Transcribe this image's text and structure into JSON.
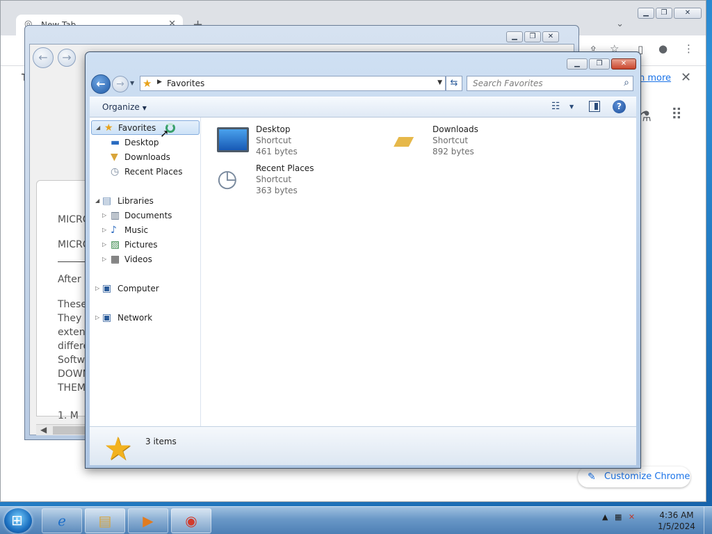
{
  "chrome": {
    "tab_title": "New Tab",
    "notice_prefix": "T",
    "learn_more": "n more",
    "customize_label": "Customize Chrome"
  },
  "document_window": {
    "lines": [
      "MICRO",
      "MICRO",
      "After i",
      "These",
      "They a",
      "extent",
      "differe",
      "Softwa",
      "DOWN",
      "THEM",
      "1.    M"
    ]
  },
  "explorer": {
    "address_crumb": "Favorites",
    "search_placeholder": "Search Favorites",
    "organize_label": "Organize",
    "help_label": "?",
    "nav_tree": {
      "favorites": "Favorites",
      "favorites_children": [
        "Desktop",
        "Downloads",
        "Recent Places"
      ],
      "libraries": "Libraries",
      "libraries_children": [
        "Documents",
        "Music",
        "Pictures",
        "Videos"
      ],
      "computer": "Computer",
      "network": "Network"
    },
    "items": [
      {
        "name": "Desktop",
        "type": "Shortcut",
        "size": "461 bytes",
        "icon": "desktop-icon"
      },
      {
        "name": "Downloads",
        "type": "Shortcut",
        "size": "892 bytes",
        "icon": "downloads-folder-icon"
      },
      {
        "name": "Recent Places",
        "type": "Shortcut",
        "size": "363 bytes",
        "icon": "recent-places-icon"
      }
    ],
    "status_text": "3 items"
  },
  "taskbar": {
    "time": "4:36 AM",
    "date": "1/5/2024"
  },
  "colors": {
    "accent": "#1a73e8",
    "selection": "#cde2f7",
    "star": "#f2b21f"
  }
}
